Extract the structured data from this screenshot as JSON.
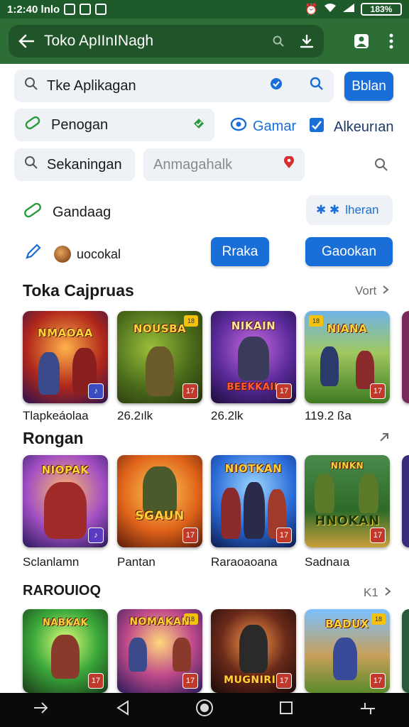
{
  "status_bar": {
    "time": "1:2:40 lnlo",
    "battery": "183%"
  },
  "app_bar": {
    "title": "Toko ApIInINagh"
  },
  "search": {
    "value": "Tke Aplikagan",
    "button": "Bblan"
  },
  "chips": {
    "penogan": "Penogan",
    "gamar": "Gamar",
    "alkeurian": "Alkeurıan",
    "sekaningan": "Sekaningan",
    "anmagahalk": "Anmagahalk"
  },
  "row3": {
    "gandaag": "Gandaag",
    "lheran": "lheran"
  },
  "row4": {
    "user": "uocokal",
    "rraka": "Rraka",
    "gaookan": "Gaookan"
  },
  "sections": [
    {
      "title": "Toka Cajpruas",
      "more": "Vort",
      "items": [
        {
          "art": "NMAOAA",
          "caption": "Tlapkeáolaa"
        },
        {
          "art": "NOUSBA",
          "caption": "26.2ılk"
        },
        {
          "art": "BEEKKAIL",
          "caption": "26.2lk"
        },
        {
          "art": "NIANA",
          "caption": "119.2 ßa"
        }
      ]
    },
    {
      "title": "Rongan",
      "more": "",
      "items": [
        {
          "art": "NIOPAK",
          "caption": "Sclanlamn"
        },
        {
          "art": "SGAUN",
          "caption": "Pantan"
        },
        {
          "art": "NIOTKAN",
          "caption": "Raraoaoana"
        },
        {
          "art": "HNOKAN",
          "caption": "Sadnaıa"
        }
      ]
    },
    {
      "title": "RAROUIOQ",
      "more": "K1",
      "items": [
        {
          "art": "NABKAK",
          "caption": ""
        },
        {
          "art": "NOMAKAN",
          "caption": ""
        },
        {
          "art": "MUGNIRIS",
          "caption": ""
        },
        {
          "art": "BADUX",
          "caption": ""
        }
      ]
    }
  ],
  "colors": {
    "appbar": "#2c6e35",
    "statusbar": "#1e5a2a",
    "accent": "#1a6ed8"
  }
}
